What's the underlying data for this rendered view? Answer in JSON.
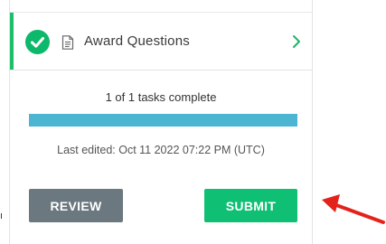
{
  "task": {
    "label": "Award Questions",
    "status": "complete",
    "status_icon": "check-circle-icon",
    "type_icon": "document-icon",
    "nav_icon": "chevron-right-icon"
  },
  "progress": {
    "text": "1 of 1 tasks complete",
    "completed": 1,
    "total": 1,
    "fraction": 1.0
  },
  "last_edited": "Last edited: Oct 11 2022 07:22 PM (UTC)",
  "buttons": {
    "review_label": "REVIEW",
    "submit_label": "SUBMIT"
  },
  "left_fragment": "ı",
  "colors": {
    "success_green": "#0cb86a",
    "submit_green": "#0fbf73",
    "review_gray": "#6b7880",
    "progress_blue": "#4cb6d2",
    "annotation_red": "#e3231b"
  }
}
